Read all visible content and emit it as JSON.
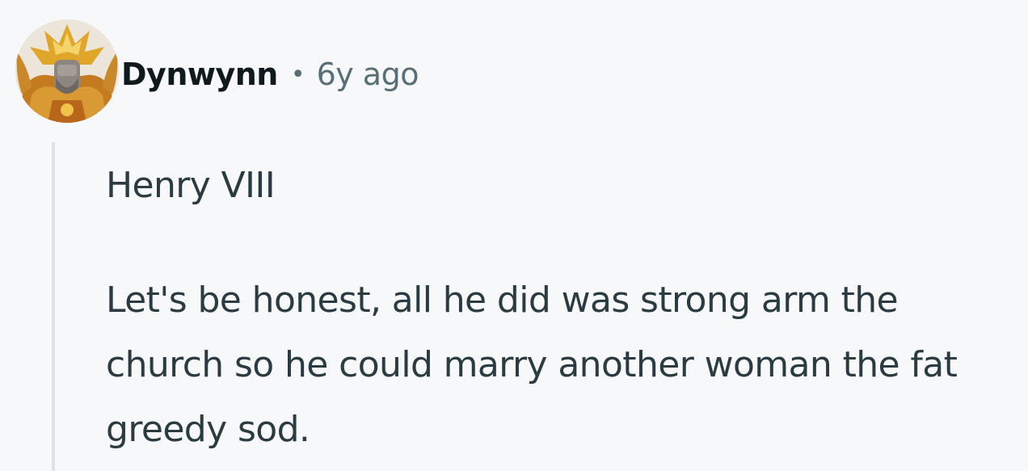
{
  "comment": {
    "author": "Dynwynn",
    "separator": "•",
    "timestamp": "6y ago",
    "avatar_icon": "gold-armored-figure-avatar",
    "paragraphs": [
      "Henry VIII",
      "Let's be honest, all he did was strong arm the church so he could marry another woman the fat greedy sod."
    ]
  },
  "colors": {
    "background": "#f7f8fa",
    "author_text": "#0f1a1c",
    "meta_text": "#576f76",
    "body_text": "#2a3c42",
    "thread_line": "#dce3ea"
  }
}
